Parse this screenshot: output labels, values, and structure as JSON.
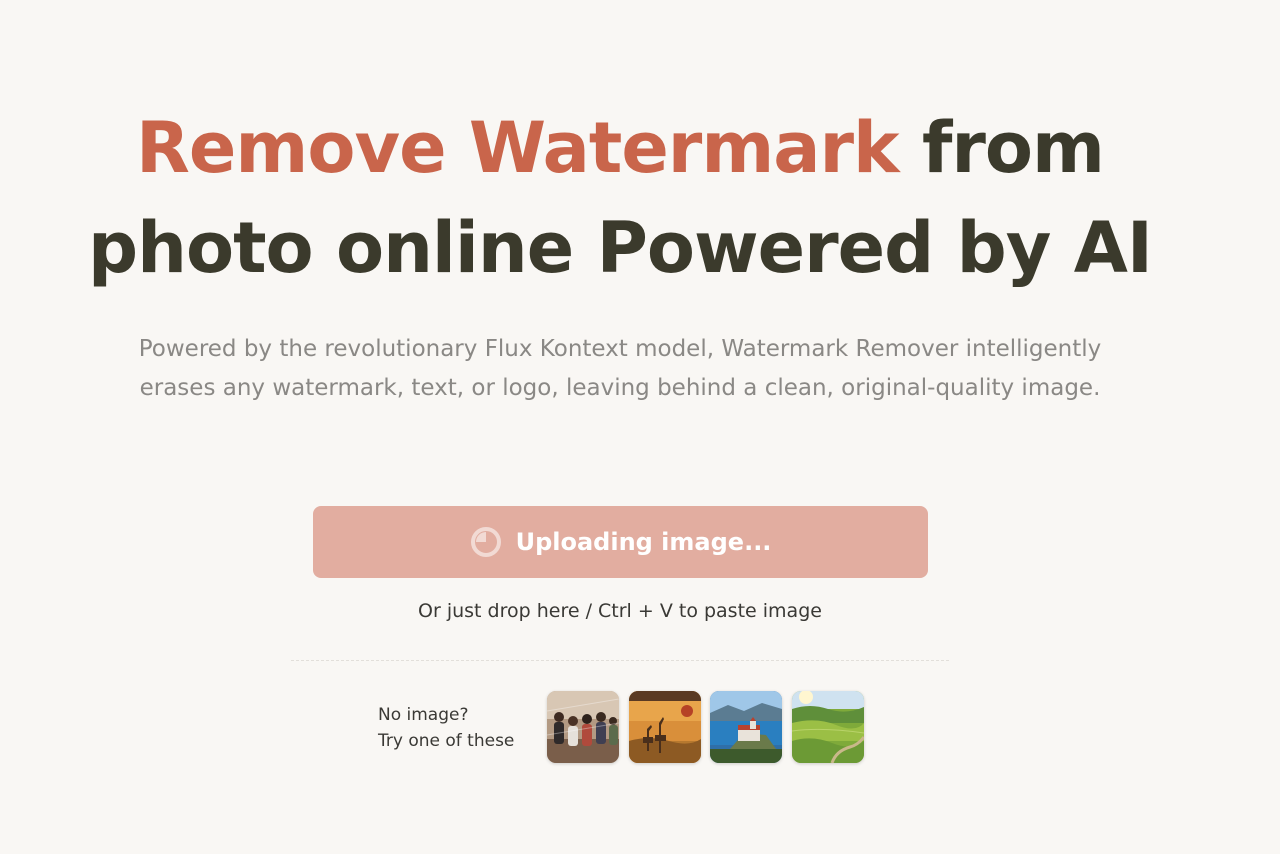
{
  "hero": {
    "title_accent": "Remove Watermark",
    "title_rest_line1": " from",
    "title_line2": "photo online Powered by AI",
    "subtitle": "Powered by the revolutionary Flux Kontext model, Watermark Remover intelligently erases any watermark, text, or logo, leaving behind a clean, original-quality image.",
    "accent_color": "#c9654b",
    "title_color": "#3b3a2c"
  },
  "upload": {
    "button_label": "Uploading image...",
    "button_color": "#e2ada0",
    "state": "loading",
    "icon": "spinner-icon",
    "drop_hint": "Or just drop here / Ctrl + V to paste image"
  },
  "samples": {
    "label_line1": "No image?",
    "label_line2": "Try one of these",
    "items": [
      {
        "name": "group-photo-sample"
      },
      {
        "name": "giraffes-sample"
      },
      {
        "name": "castle-lake-sample"
      },
      {
        "name": "green-hills-sample"
      }
    ]
  }
}
